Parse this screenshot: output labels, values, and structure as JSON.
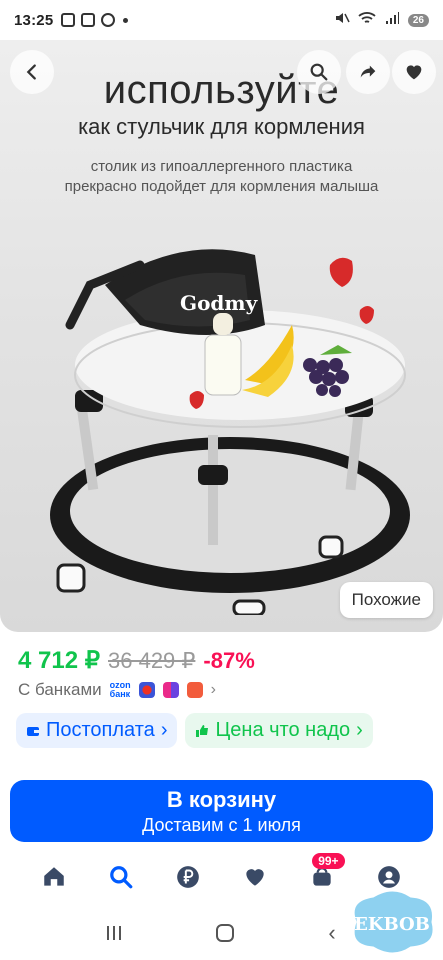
{
  "status_bar": {
    "time": "13:25",
    "battery": "26"
  },
  "hero": {
    "title": "используйте",
    "subtitle": "как стульчик для кормления",
    "desc_line1": "столик из гипоаллергенного пластика",
    "desc_line2": "прекрасно подойдет для кормления малыша",
    "brand": "Godmy",
    "similar_label": "Похожие"
  },
  "price": {
    "current": "4 712 ₽",
    "old": "36 429 ₽",
    "discount": "-87%"
  },
  "banks": {
    "label": "С банками",
    "ozon_top": "ozon",
    "ozon_bottom": "банк"
  },
  "pills": {
    "postpay": "Постоплата",
    "fair_price": "Цена что надо"
  },
  "cta": {
    "main": "В корзину",
    "sub": "Доставим с 1 июля"
  },
  "nav": {
    "cart_badge": "99+"
  },
  "watermark": {
    "text": "EKBOB"
  },
  "colors": {
    "accent": "#005bff",
    "price": "#10c44c",
    "discount": "#f91155"
  }
}
